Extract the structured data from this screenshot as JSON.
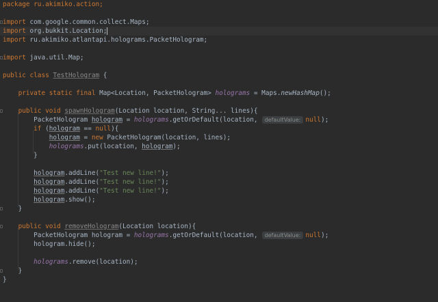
{
  "editor": {
    "lines": {
      "l1": "package ru.akimiko.action;",
      "l3a": "import",
      "l3b": " com.google.common.collect.Maps;",
      "l4a": "import",
      "l4b": " org.bukkit.Location;",
      "l5a": "import",
      "l5b": " ru.akimiko.atlantapi.holograms.PacketHologram;",
      "l7a": "import",
      "l7b": " java.util.Map;",
      "l9a": "public class ",
      "l9b": "TestHologram",
      "l9c": " {",
      "l11a": "    private static final ",
      "l11b": "Map<Location, PacketHologram> ",
      "l11c": "holograms",
      "l11d": " = Maps.",
      "l11e": "newHashMap",
      "l11f": "();",
      "l13a": "    public void ",
      "l13b": "spawnHologram",
      "l13c": "(Location location, String... lines){",
      "l14a": "        PacketHologram ",
      "l14b": "hologram",
      "l14c": " = ",
      "l14d": "holograms",
      "l14e": ".getOrDefault(location,",
      "l14hint": "defaultValue:",
      "l14f": "null",
      "l14g": ");",
      "l15a": "        if",
      "l15b": " (",
      "l15c": "hologram",
      "l15d": " == ",
      "l15e": "null",
      "l15f": "){",
      "l16a": "            ",
      "l16b": "hologram",
      "l16c": " = ",
      "l16d": "new",
      "l16e": " PacketHologram(location, lines);",
      "l17a": "            ",
      "l17b": "holograms",
      "l17c": ".put(location, ",
      "l17d": "hologram",
      "l17e": ");",
      "l18": "        }",
      "l20a": "        ",
      "l20b": "hologram",
      "l20c": ".addLine(",
      "l20d": "\"Test new line!\"",
      "l20e": ");",
      "l21b": "hologram",
      "l21c": ".addLine(",
      "l21d": "\"Test new line!\"",
      "l21e": ");",
      "l22b": "hologram",
      "l22c": ".addLine(",
      "l22d": "\"Test new line!\"",
      "l22e": ");",
      "l23b": "hologram",
      "l23c": ".show();",
      "l24": "    }",
      "l26a": "    public void ",
      "l26b": "removeHologram",
      "l26c": "(Location location){",
      "l27a": "        PacketHologram hologram = ",
      "l27b": "holograms",
      "l27c": ".getOrDefault(location,",
      "l27hint": "defaultValue:",
      "l27d": "null",
      "l27e": ");",
      "l28": "        hologram.hide();",
      "l30a": "        ",
      "l30b": "holograms",
      "l30c": ".remove(location);",
      "l31": "    }",
      "l32": "}"
    }
  },
  "colors": {
    "background": "#2b2b2b",
    "keyword": "#cc7832",
    "string": "#6a8759",
    "field": "#9876aa",
    "text": "#a9b7c6"
  }
}
